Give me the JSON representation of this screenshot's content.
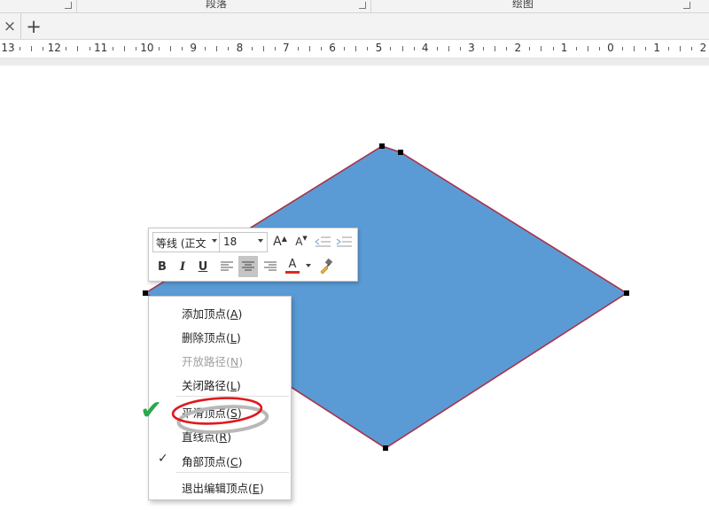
{
  "ribbon": {
    "groups": [
      {
        "label": "段落"
      },
      {
        "label": "绘图"
      }
    ]
  },
  "tabbar": {
    "close_glyph": "×",
    "add_glyph": "+"
  },
  "ruler": {
    "labels": [
      "13",
      "12",
      "11",
      "10",
      "9",
      "8",
      "7",
      "6",
      "5",
      "4",
      "3",
      "2",
      "1",
      "0",
      "1",
      "2"
    ]
  },
  "shape": {
    "fill_color": "#5b9bd5",
    "outline_color": "#a8324a"
  },
  "mini_toolbar": {
    "font_name": "等线 (正文",
    "font_size": "18",
    "grow_font": "A",
    "shrink_font": "A",
    "bold": "B",
    "italic": "I",
    "underline": "U",
    "font_color_letter": "A",
    "font_color": "#e0281e"
  },
  "context_menu": {
    "items": [
      {
        "label": "添加顶点",
        "key": "(A)",
        "enabled": true,
        "checked": false
      },
      {
        "label": "删除顶点",
        "key": "(L)",
        "enabled": true,
        "checked": false
      },
      {
        "label": "开放路径",
        "key": "(N)",
        "enabled": false,
        "checked": false
      },
      {
        "label": "关闭路径",
        "key": "(L)",
        "enabled": true,
        "checked": false
      },
      {
        "label": "平滑顶点",
        "key": "(S)",
        "enabled": true,
        "checked": false
      },
      {
        "label": "直线点",
        "key": "(R)",
        "enabled": true,
        "checked": false
      },
      {
        "label": "角部顶点",
        "key": "(C)",
        "enabled": true,
        "checked": true
      },
      {
        "label": "退出编辑顶点",
        "key": "(E)",
        "enabled": true,
        "checked": false
      }
    ]
  },
  "annotation": {
    "check_glyph": "✔",
    "check_color": "#2aa84a",
    "ring_color": "#e0191e"
  }
}
